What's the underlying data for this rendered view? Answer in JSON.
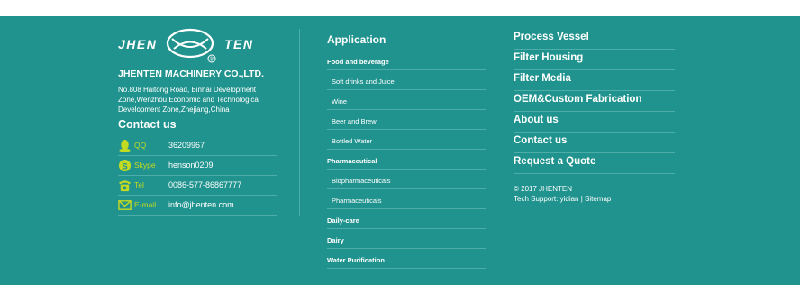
{
  "brand": {
    "logo_left": "JHEN",
    "logo_right": "TEN",
    "registered": "®",
    "company": "JHENTEN MACHINERY CO.,LTD.",
    "address": "No.808 Haitong Road, Binhai Development Zone,Wenzhou Economic and Technological Development Zone,Zhejiang,China"
  },
  "contact": {
    "title": "Contact us",
    "rows": [
      {
        "icon": "qq-penguin-icon",
        "label": "QQ",
        "value": "36209967"
      },
      {
        "icon": "skype-icon",
        "label": "Skype",
        "value": "henson0209"
      },
      {
        "icon": "telephone-icon",
        "label": "Tel",
        "value": "0086-577-86867777"
      },
      {
        "icon": "envelope-icon",
        "label": "E-mail",
        "value": "info@jhenten.com"
      }
    ]
  },
  "application": {
    "title": "Application",
    "items": [
      {
        "label": "Food and beverage",
        "type": "category"
      },
      {
        "label": "Soft drinks and Juice",
        "type": "sub"
      },
      {
        "label": "Wine",
        "type": "sub"
      },
      {
        "label": "Beer and Brew",
        "type": "sub"
      },
      {
        "label": "Bottled Water",
        "type": "sub"
      },
      {
        "label": "Pharmaceutical",
        "type": "category"
      },
      {
        "label": "Biopharmaceuticals",
        "type": "sub"
      },
      {
        "label": "Pharmaceuticals",
        "type": "sub"
      },
      {
        "label": "Daily-care",
        "type": "category"
      },
      {
        "label": "Dairy",
        "type": "category"
      },
      {
        "label": "Water Purification",
        "type": "category"
      }
    ]
  },
  "products": [
    "Process Vessel",
    "Filter Housing",
    "Filter Media",
    "OEM&Custom Fabrication",
    "About us",
    "Contact us",
    "Request a Quote"
  ],
  "copyright": {
    "line1": "© 2017 JHENTEN",
    "line2": "Tech Support: yidian | Sitemap"
  },
  "colors": {
    "footer_bg": "#21938e",
    "accent": "#c3da22",
    "divider": "#4dada8"
  }
}
